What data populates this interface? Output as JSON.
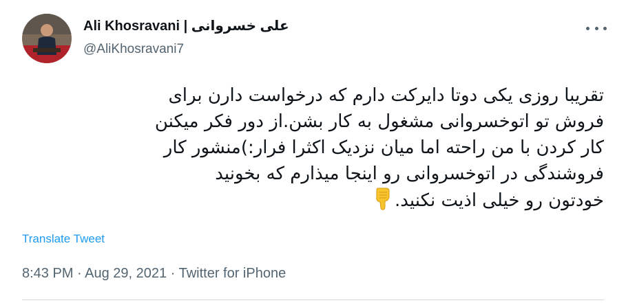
{
  "tweet": {
    "author": {
      "display_name": "Ali Khosravani | علی خسروانی",
      "handle": "@AliKhosravani7"
    },
    "body_lines": [
      "تقریبا روزی یکی دوتا دایرکت دارم که درخواست دارن برای",
      "فروش تو اتوخسروانی مشغول به کار بشن.از دور فکر میکنن",
      "کار کردن با من راحته اما میان نزدیک اکثرا فرار:)منشور کار",
      "فروشندگی در اتوخسروانی رو اینجا میذارم که بخونید",
      "خودتون رو خیلی اذیت نکنید."
    ],
    "emoji_icon": "backhand-index-pointing-down",
    "translate_label": "Translate Tweet",
    "meta": {
      "time": "8:43 PM",
      "date": "Aug 29, 2021",
      "source": "Twitter for iPhone",
      "separator": " · "
    }
  },
  "colors": {
    "link": "#1d9bf0",
    "secondary_text": "#536471",
    "primary_text": "#0f1419",
    "divider": "#cfd9de",
    "emoji": "#f7c52b"
  }
}
